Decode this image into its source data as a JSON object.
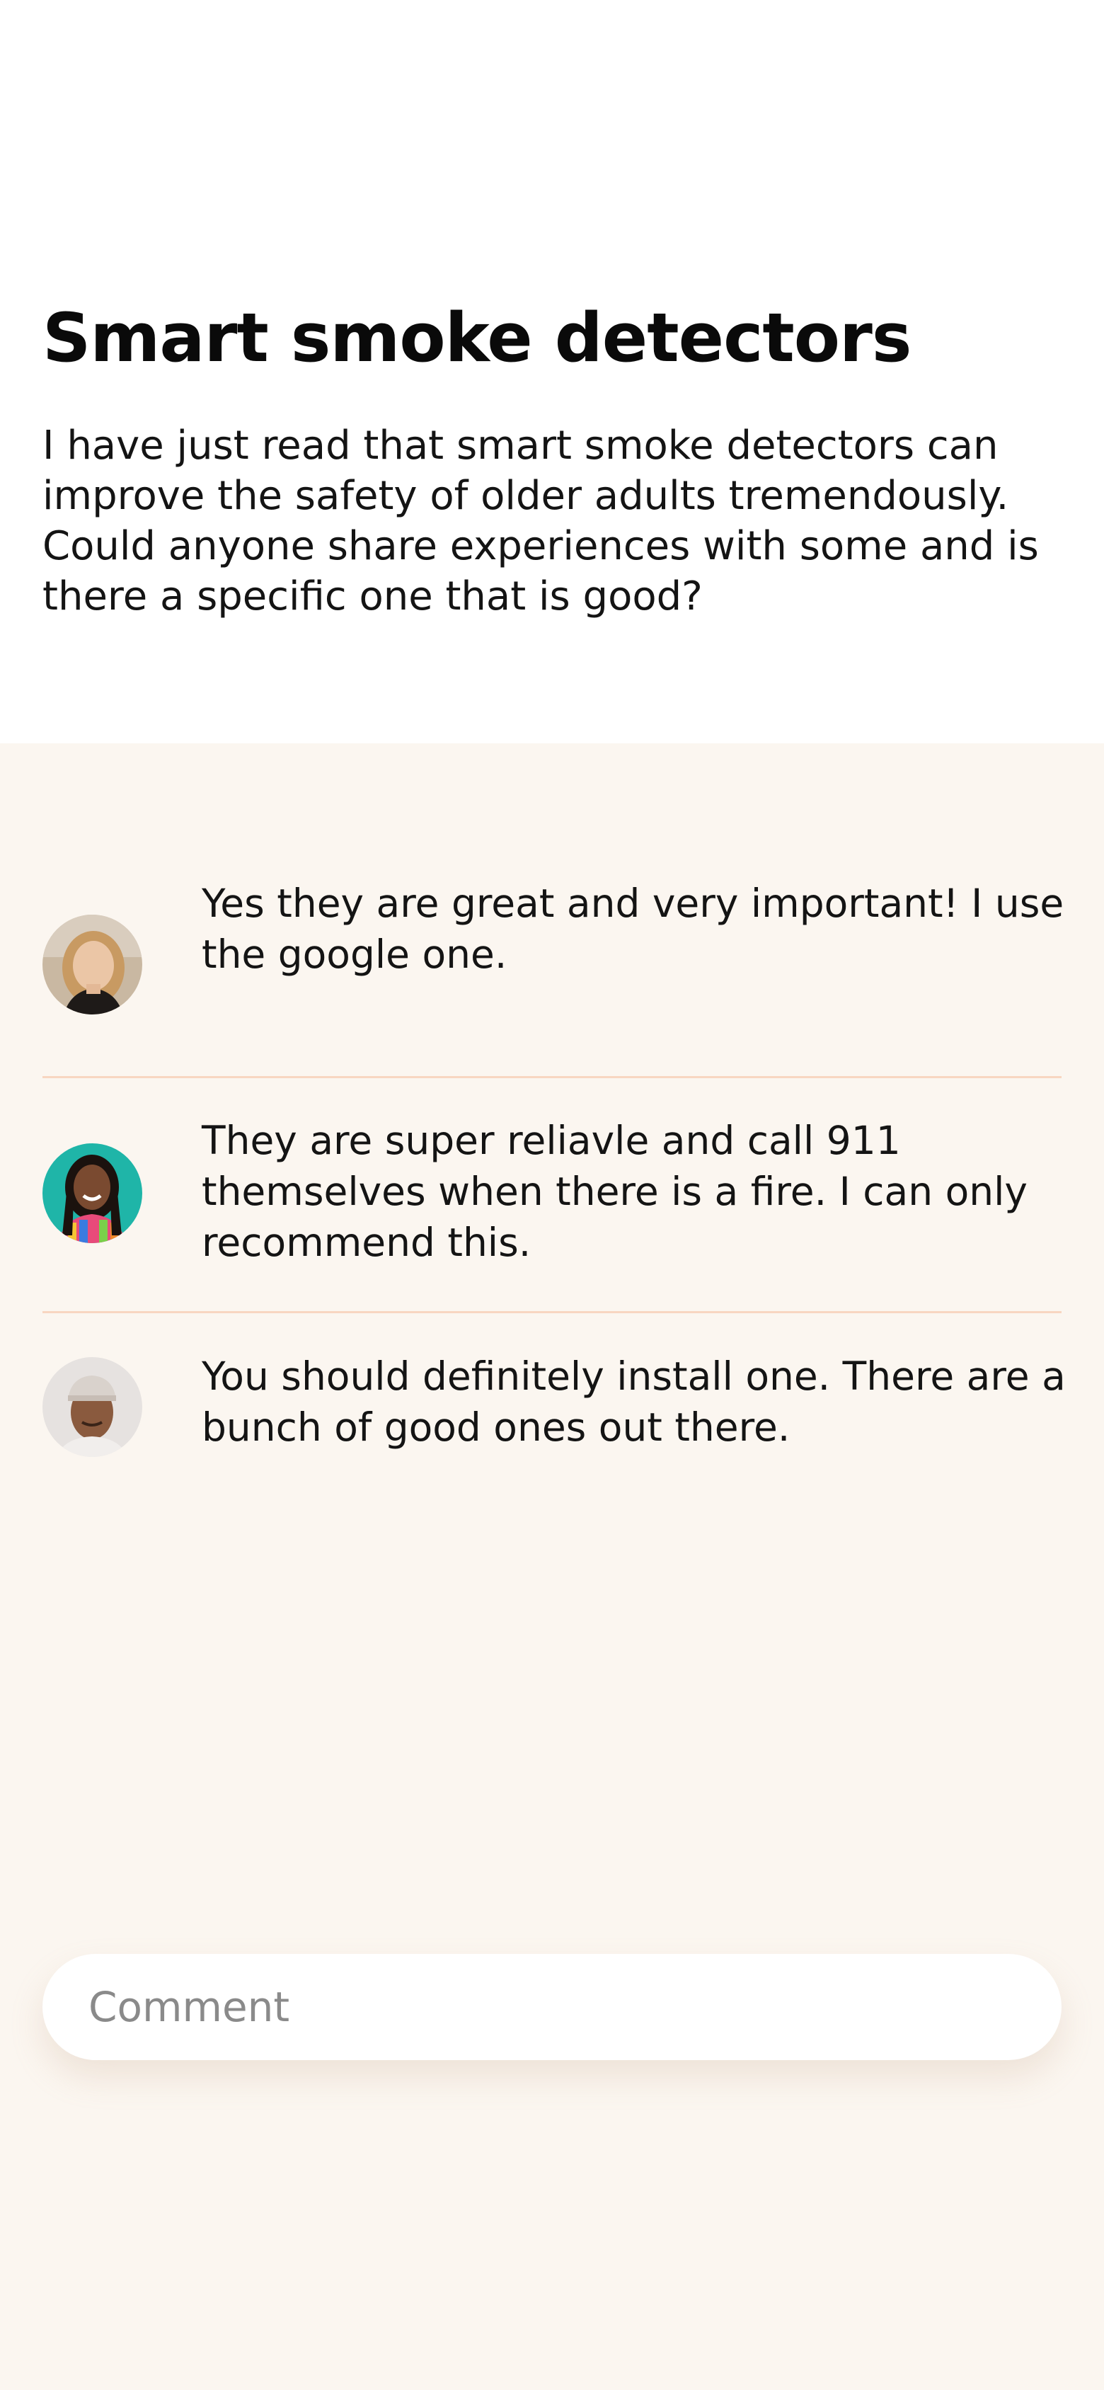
{
  "post": {
    "title": "Smart smoke detectors",
    "body": "I have just read that smart smoke detectors can improve the safety of older adults tremendously. Could anyone share experiences with some and is there a specific one that is good?"
  },
  "comments": [
    {
      "text": "Yes they are great and very important! I use the google one.",
      "avatar_icon": "blonde-woman-avatar"
    },
    {
      "text": "They are super reliavle and call 911 themselves when there is a fire. I can only recommend this.",
      "avatar_icon": "smiling-woman-teal-background-avatar"
    },
    {
      "text": "You should definitely install one. There are a bunch of good ones out there.",
      "avatar_icon": "older-man-cap-avatar"
    }
  ],
  "comment_input": {
    "placeholder": "Comment",
    "value": ""
  },
  "colors": {
    "background": "#FBF6F0",
    "header_background": "#FFFFFF",
    "divider": "#F8D6C1",
    "text": "#141414",
    "placeholder": "#8A8A8A"
  }
}
